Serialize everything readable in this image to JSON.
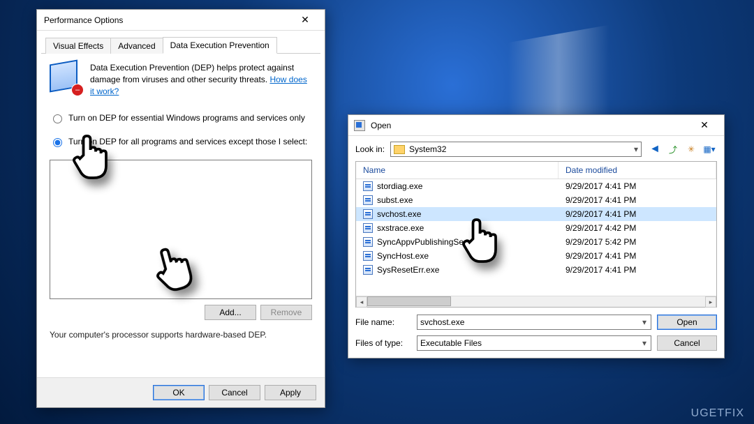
{
  "perf": {
    "title": "Performance Options",
    "tabs": [
      "Visual Effects",
      "Advanced",
      "Data Execution Prevention"
    ],
    "active_tab": 2,
    "desc_prefix": "Data Execution Prevention (DEP) helps protect against damage from viruses and other security threats. ",
    "desc_link": "How does it work?",
    "radio1": "Turn on DEP for essential Windows programs and services only",
    "radio2": "Turn on DEP for all programs and services except those I select:",
    "add": "Add...",
    "remove": "Remove",
    "support": "Your computer's processor supports hardware-based DEP.",
    "ok": "OK",
    "cancel": "Cancel",
    "apply": "Apply"
  },
  "open": {
    "title": "Open",
    "look_in": "Look in:",
    "folder": "System32",
    "col_name": "Name",
    "col_date": "Date modified",
    "files": [
      {
        "name": "stordiag.exe",
        "date": "9/29/2017 4:41 PM"
      },
      {
        "name": "subst.exe",
        "date": "9/29/2017 4:41 PM"
      },
      {
        "name": "svchost.exe",
        "date": "9/29/2017 4:41 PM",
        "selected": true
      },
      {
        "name": "sxstrace.exe",
        "date": "9/29/2017 4:42 PM"
      },
      {
        "name": "SyncAppvPublishingServer.exe",
        "date": "9/29/2017 5:42 PM"
      },
      {
        "name": "SyncHost.exe",
        "date": "9/29/2017 4:41 PM"
      },
      {
        "name": "SysResetErr.exe",
        "date": "9/29/2017 4:41 PM"
      }
    ],
    "filename_label": "File name:",
    "filename_value": "svchost.exe",
    "filetypes_label": "Files of type:",
    "filetypes_value": "Executable Files",
    "open_btn": "Open",
    "cancel_btn": "Cancel"
  },
  "watermark": "UGETFIX"
}
